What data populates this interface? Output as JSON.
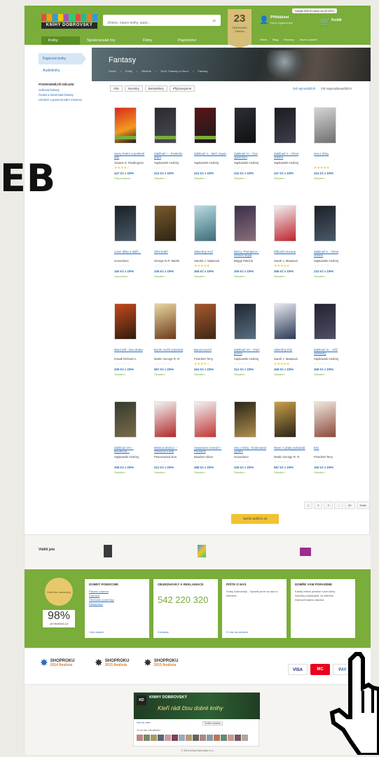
{
  "overlay_text": "EB",
  "header": {
    "logo_text": "KNIHY DOBROVSKÝ",
    "search_placeholder": "Jméno, název knihy, autor...",
    "nav": [
      "Knihy",
      "Společenské hry",
      "Filmy",
      "Papírnictví"
    ],
    "date_day": "23",
    "date_month": "ČERVENEC",
    "date_name": "Zdeňka",
    "login_title": "Přihlášení",
    "login_sub": "Nový registrovaný",
    "cart_label": "Košík",
    "top_notice": "Volejte 590 51 Akce na 20 DPH",
    "subnav": [
      "Sleva",
      "Blog",
      "Provozy",
      "Akce a soutěž"
    ]
  },
  "sidebar": {
    "active_category": "Papírové knihy",
    "audiobooks": "Audioknihy",
    "heading": "PODROBNĚJŠÍ DĚLENÍ",
    "subcategories": [
      "Světová fantasy",
      "Česká a slovenská fantasy",
      "Literární a paranormální romance"
    ]
  },
  "banner": {
    "title": "Fantasy",
    "breadcrumbs": [
      "Domů",
      "Knihy",
      "Beletrie",
      "Sci-fi, Fantasy a Horor",
      "Fantasy"
    ]
  },
  "filters": [
    "Vše",
    "Novinky",
    "Bestsellery",
    "Připravujeme"
  ],
  "sorting": [
    "Od nejnovějších",
    "Od nejprodávanějších"
  ],
  "products": [
    {
      "title": "Harry Potter a prokleté dítě",
      "author": "Joanne K. Rowlingová",
      "stars": "★★★★☆",
      "price": "447 Kč s DPH",
      "availability": "Připravujeme"
    },
    {
      "title": "Zaklínač I. - Poslední přání",
      "author": "Sapkowski Andrzej",
      "stars": "☆☆☆☆☆",
      "price": "223 Kč s DPH",
      "availability": "Skladem"
    },
    {
      "title": "Zaklínač II. - Meč osudu",
      "author": "Sapkowski Andrzej",
      "stars": "☆☆☆☆☆",
      "price": "223 Kč s DPH",
      "availability": "Skladem"
    },
    {
      "title": "Zaklínač IV. - Čas opovržení",
      "author": "Sapkowski Andrzej",
      "stars": "☆☆☆☆☆",
      "price": "232 Kč s DPH",
      "availability": "Skladem"
    },
    {
      "title": "Zaklínač V. - Křest ohněm",
      "author": "Sapkowski Andrzej",
      "stars": "☆☆☆☆☆",
      "price": "247 Kč s DPH",
      "availability": "Skladem"
    },
    {
      "title": "Hra o trůny",
      "author": "",
      "stars": "★★★★★",
      "price": "334 Kč s DPH",
      "availability": "Skladem"
    },
    {
      "title": "Lesní dítky a další...",
      "author": "neuvedeno",
      "stars": "☆☆☆☆☆",
      "price": "150 Kč s DPH",
      "availability": "Vyprodáno"
    },
    {
      "title": "Střet králů",
      "author": "George R.R. Martin",
      "stars": "☆☆☆☆☆",
      "price": "336 Kč s DPH",
      "availability": "Skladem"
    },
    {
      "title": "Skleněný meč",
      "author": "Sandra J. Maasová",
      "stars": "★★★★★",
      "price": "368 Kč s DPH",
      "availability": "Skladem"
    },
    {
      "title": "Mercy Thompson - Ohnivá stopa",
      "author": "Briggs Patricia",
      "stars": "☆☆☆☆☆",
      "price": "259 Kč s DPH",
      "availability": "Skladem"
    },
    {
      "title": "Půlnoční koruna",
      "author": "Sarah J. Maasová",
      "stars": "★★★★★",
      "price": "368 Kč s DPH",
      "availability": "Skladem"
    },
    {
      "title": "Zaklínač V. - Křest ohněm",
      "author": "Sapkowski Andrzej",
      "stars": "☆☆☆☆☆",
      "price": "233 Kč s DPH",
      "availability": "Skladem"
    },
    {
      "title": "WarCraft - Den draka",
      "author": "Knaak Richard A.",
      "stars": "☆☆☆☆☆",
      "price": "208 Kč s DPH",
      "availability": "Skladem"
    },
    {
      "title": "Bouře mečů (vázaná)",
      "author": "Martin George R. R.",
      "stars": "☆☆☆☆☆",
      "price": "587 Kč s DPH",
      "availability": "Skladem"
    },
    {
      "title": "Barva kouzel",
      "author": "Pratchett Terry",
      "stars": "★★★★☆",
      "price": "264 Kč s DPH",
      "availability": "Skladem"
    },
    {
      "title": "Zaklínač VII. - Paní jezera",
      "author": "Sapkowski Andrzej",
      "stars": "☆☆☆☆☆",
      "price": "312 Kč s DPH",
      "availability": "Skladem"
    },
    {
      "title": "Skleněný trůn",
      "author": "Sarah J. Maasová",
      "stars": "★★★★★",
      "price": "368 Kč s DPH",
      "availability": "Skladem"
    },
    {
      "title": "Zaklínač VI. - Věž vlaštovky",
      "author": "Sapkowski Andrzej",
      "stars": "☆☆☆☆☆",
      "price": "368 Kč s DPH",
      "availability": "Skladem"
    },
    {
      "title": "Zaklínač VIII. - Bouřková...",
      "author": "Sapkowski Andrzej",
      "stars": "☆☆☆☆☆",
      "price": "258 Kč s DPH",
      "availability": "Skladem"
    },
    {
      "title": "Mistrovi druhu I. - Odvrácení dítě",
      "author": "Peternasová Eva",
      "stars": "☆☆☆☆☆",
      "price": "312 Kč s DPH",
      "availability": "Skladem"
    },
    {
      "title": "Assassin's Creed II - Pouštník",
      "author": "Bowden Oliver",
      "stars": "☆☆☆☆☆",
      "price": "288 Kč s DPH",
      "availability": "Skladem"
    },
    {
      "title": "Hra o trůny - Ilustrované vydání",
      "author": "neuvedeno",
      "stars": "☆☆☆☆☆",
      "price": "336 Kč s DPH",
      "availability": "Skladem"
    },
    {
      "title": "Tanec s draky (vázaná)",
      "author": "Martin George R. R.",
      "stars": "☆☆☆☆☆",
      "price": "587 Kč s DPH",
      "availability": "Skladem"
    },
    {
      "title": "Eric",
      "author": "Pratchett Terry",
      "stars": "☆☆☆☆☆",
      "price": "150 Kč s DPH",
      "availability": "Skladem"
    }
  ],
  "pagination": [
    "1",
    "2",
    "3",
    "...",
    "30",
    "Další"
  ],
  "load_more": "Načíst dalších 24",
  "visited_label": "Viděli jste",
  "info": {
    "percent": "98%",
    "percent_sub": "od Heurekou.cz",
    "badge_label": "Ověřeno zákazníky",
    "card1_title": "DOBRÝ POMOCNÍK",
    "card1_links": [
      "Placení zdarma",
      "Doprava",
      "Obchodní podmínky",
      "Reklamace"
    ],
    "card1_more": "Více otázek",
    "card2_title": "OBJEDNÁVKY A REKLAMACE",
    "phone": "542 220 320",
    "card2_more": "Kontakty",
    "card3_title": "PIŠTE O NÁS",
    "card3_text": "Knihy Dobrovský - Vyrazili jsme na akci a knihami...",
    "card3_more": "O nás na webech",
    "card4_title": "DOBŘE VÁM PORADÍME",
    "card4_items": [
      "Každý měsíc přinese nové knihy",
      "Novinky prodavačů, do kterého",
      "Dárkové balení zdarma"
    ]
  },
  "awards": [
    {
      "name": "SHOPROKU",
      "year": "2014 finalista"
    },
    {
      "name": "SHOPROKU",
      "year": "2015 finalista"
    },
    {
      "name": "SHOPROKU",
      "year": "2015 finalista"
    }
  ],
  "payments": [
    "VISA",
    "MC",
    "PAY"
  ],
  "footer": {
    "fb_brand": "KNIHY DOBROVSKÝ",
    "fb_slogan": "Kteří rádi čtou dobré knihy",
    "fb_like": "Líbí se vám",
    "fb_share": "Sdílet stránku",
    "fb_count": "To se líbí uživatelům",
    "copyright": "© 2016 Knihy Dobrovský s.r.o."
  },
  "colors": {
    "brand_green": "#7aad3a",
    "link_blue": "#2a6db5",
    "accent_yellow": "#f1c232"
  }
}
